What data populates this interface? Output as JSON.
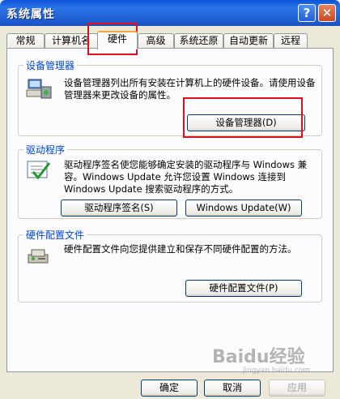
{
  "window": {
    "title": "系统属性",
    "help": "?",
    "close": "✕"
  },
  "tabs": [
    {
      "label": "常规"
    },
    {
      "label": "计算机名"
    },
    {
      "label": "硬件"
    },
    {
      "label": "高级"
    },
    {
      "label": "系统还原"
    },
    {
      "label": "自动更新"
    },
    {
      "label": "远程"
    }
  ],
  "device_manager": {
    "title": "设备管理器",
    "desc": "设备管理器列出所有安装在计算机上的硬件设备。请使用设备管理器来更改设备的属性。",
    "button": "设备管理器(D)"
  },
  "drivers": {
    "title": "驱动程序",
    "desc": "驱动程序签名使您能够确定安装的驱动程序与 Windows 兼容。Windows Update 允许您设置 Windows 连接到 Windows Update 搜索驱动程序的方式。",
    "sign_button": "驱动程序签名(S)",
    "update_button": "Windows Update(W)"
  },
  "hw_profiles": {
    "title": "硬件配置文件",
    "desc": "硬件配置文件向您提供建立和保存不同硬件配置的方法。",
    "button": "硬件配置文件(P)"
  },
  "footer": {
    "ok": "确定",
    "cancel": "取消",
    "apply": "应用"
  },
  "watermark": {
    "brand": "Baidu经验",
    "url": "jingyan.baidu.com"
  },
  "colors": {
    "highlight": "#e0101a",
    "group_title": "#0046d5",
    "titlebar": "#1e5ad0"
  }
}
